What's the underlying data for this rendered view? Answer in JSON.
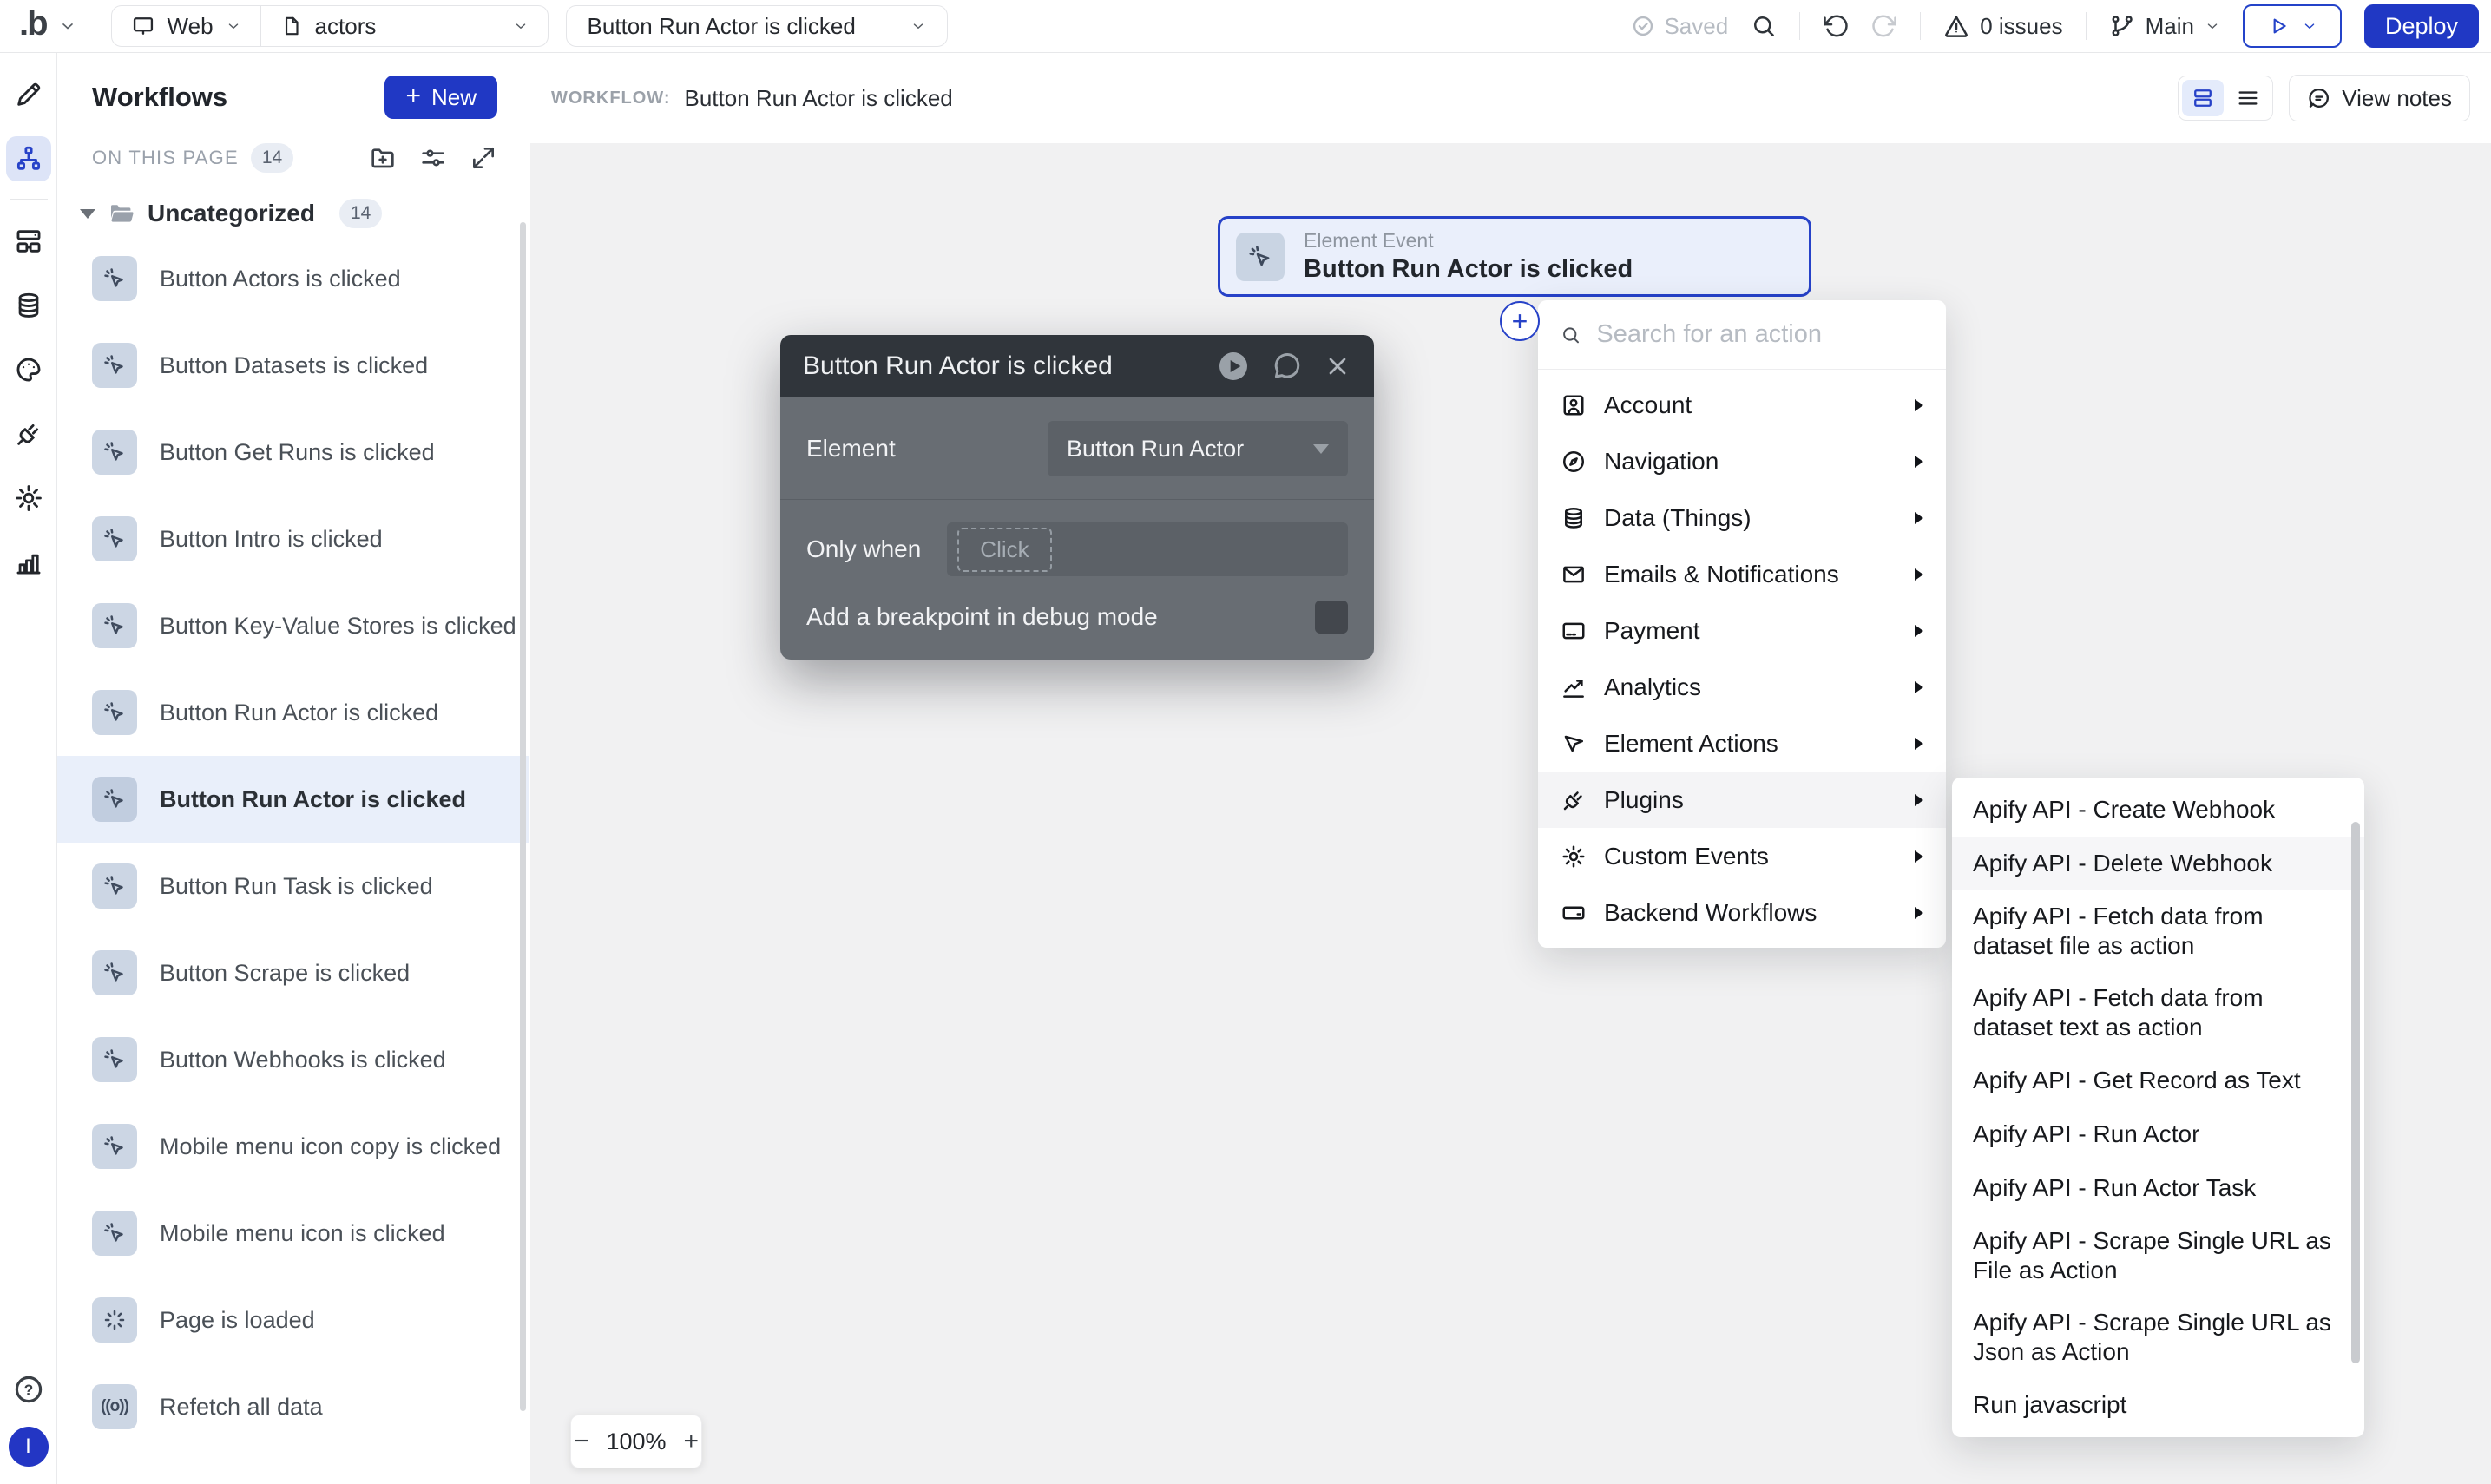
{
  "topbar": {
    "logo": ".b",
    "platform_label": "Web",
    "page_label": "actors",
    "workflow_selector": "Button Run Actor is clicked",
    "saved_label": "Saved",
    "issues_label": "0 issues",
    "branch_label": "Main",
    "deploy_label": "Deploy"
  },
  "rail": {
    "items": [
      "design",
      "workflows",
      "components",
      "data",
      "styles",
      "plugins",
      "settings",
      "logs"
    ],
    "active_item": "workflows",
    "help_glyph": "?",
    "avatar_initial": "I"
  },
  "panel": {
    "title": "Workflows",
    "new_button_plus": "+",
    "new_button": "New",
    "section_label": "ON THIS PAGE",
    "section_count": "14",
    "folder_name": "Uncategorized",
    "folder_count": "14",
    "refetch_icon_glyph": "((o))",
    "items": [
      {
        "label": "Button Actors is clicked"
      },
      {
        "label": "Button Datasets is clicked"
      },
      {
        "label": "Button Get Runs is clicked"
      },
      {
        "label": "Button Intro is clicked"
      },
      {
        "label": "Button Key-Value Stores is clicked"
      },
      {
        "label": "Button Run Actor is clicked"
      },
      {
        "label": "Button Run Actor is clicked"
      },
      {
        "label": "Button Run Task is clicked"
      },
      {
        "label": "Button Scrape is clicked"
      },
      {
        "label": "Button Webhooks is clicked"
      },
      {
        "label": "Mobile menu icon copy is clicked"
      },
      {
        "label": "Mobile menu icon is clicked"
      },
      {
        "label": "Page is loaded"
      },
      {
        "label": "Refetch all data"
      }
    ],
    "selected_index": 6
  },
  "canvas": {
    "workflow_label": "WORKFLOW:",
    "workflow_title": "Button Run Actor is clicked",
    "view_notes_label": "View notes",
    "node_kind": "Element Event",
    "node_title": "Button Run Actor is clicked",
    "zoom_minus": "−",
    "zoom_level": "100%",
    "zoom_plus": "+"
  },
  "dialog": {
    "title": "Button Run Actor is clicked",
    "element_label": "Element",
    "element_value": "Button Run Actor",
    "only_when_label": "Only when",
    "only_when_chip": "Click",
    "breakpoint_label": "Add a breakpoint in debug mode"
  },
  "action_menu": {
    "search_placeholder": "Search for an action",
    "categories": [
      {
        "label": "Account",
        "icon": "id-card-icon"
      },
      {
        "label": "Navigation",
        "icon": "compass-icon"
      },
      {
        "label": "Data (Things)",
        "icon": "database-icon"
      },
      {
        "label": "Emails & Notifications",
        "icon": "envelope-icon"
      },
      {
        "label": "Payment",
        "icon": "credit-card-icon"
      },
      {
        "label": "Analytics",
        "icon": "trend-icon"
      },
      {
        "label": "Element Actions",
        "icon": "cursor-icon"
      },
      {
        "label": "Plugins",
        "icon": "plug-icon"
      },
      {
        "label": "Custom Events",
        "icon": "gear-icon"
      },
      {
        "label": "Backend Workflows",
        "icon": "card-icon"
      }
    ],
    "highlighted_category": "Plugins"
  },
  "plugins_submenu": {
    "items": [
      {
        "label": "Apify API - Create Webhook"
      },
      {
        "label": "Apify API - Delete Webhook"
      },
      {
        "label": "Apify API - Fetch data from dataset file as action"
      },
      {
        "label": "Apify API - Fetch data from dataset text as action"
      },
      {
        "label": "Apify API - Get Record as Text"
      },
      {
        "label": "Apify API - Run Actor"
      },
      {
        "label": "Apify API - Run Actor Task"
      },
      {
        "label": "Apify API - Scrape Single URL as File as Action"
      },
      {
        "label": "Apify API - Scrape Single URL as Json as Action"
      },
      {
        "label": "Run javascript"
      }
    ],
    "highlighted_item": "Apify API - Delete Webhook"
  },
  "colors": {
    "accent_blue": "#2038c4",
    "node_border_blue": "#2742c8",
    "canvas_bg": "#f1f1f2",
    "dialog_header_bg": "#30353b",
    "dialog_body_bg": "#686d73",
    "selected_row_bg": "#e9effa",
    "icon_tile_bg": "#ccd6e4"
  }
}
